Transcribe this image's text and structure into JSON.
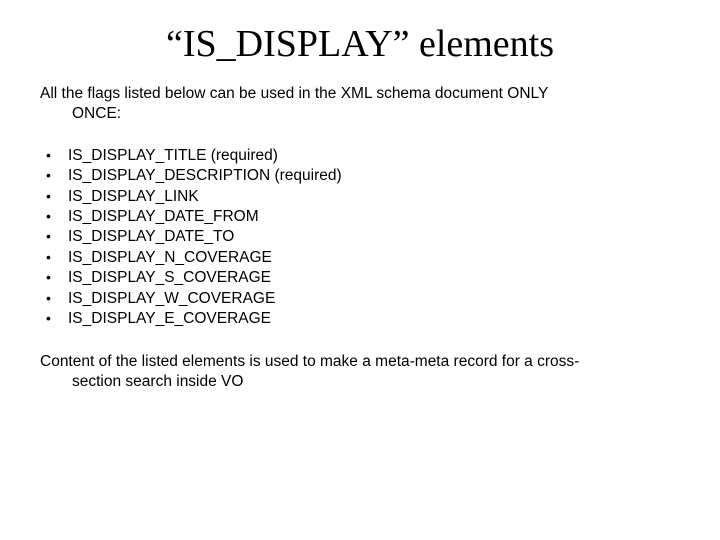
{
  "title": "“IS_DISPLAY” elements",
  "intro_line1": "All the flags listed below can be used in the XML schema document ONLY",
  "intro_line2": "ONCE:",
  "flags": [
    {
      "name": "IS_DISPLAY_TITLE",
      "suffix": " (required)"
    },
    {
      "name": "IS_DISPLAY_DESCRIPTION",
      "suffix": " (required)"
    },
    {
      "name": "IS_DISPLAY_LINK",
      "suffix": ""
    },
    {
      "name": "IS_DISPLAY_DATE_FROM",
      "suffix": ""
    },
    {
      "name": "IS_DISPLAY_DATE_TO",
      "suffix": ""
    },
    {
      "name": "IS_DISPLAY_N_COVERAGE",
      "suffix": ""
    },
    {
      "name": "IS_DISPLAY_S_COVERAGE",
      "suffix": ""
    },
    {
      "name": "IS_DISPLAY_W_COVERAGE",
      "suffix": ""
    },
    {
      "name": "IS_DISPLAY_E_COVERAGE",
      "suffix": ""
    }
  ],
  "closing_line1": "Content of the listed elements is used to make a meta-meta record for a cross-",
  "closing_line2": "section search inside VO"
}
